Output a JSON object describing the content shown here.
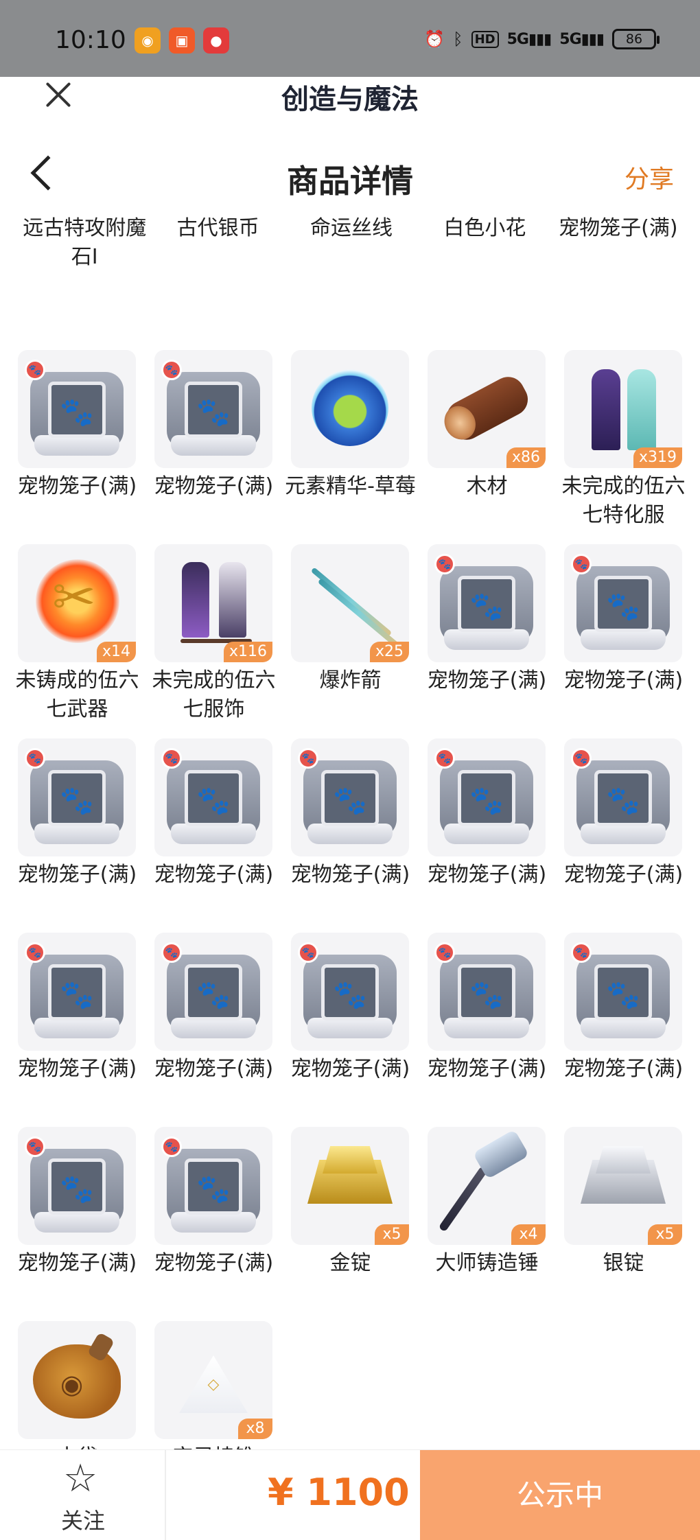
{
  "status_bar": {
    "time": "10:10",
    "network_hd": "HD",
    "signal_1": "5G",
    "signal_2": "5G",
    "battery": "86"
  },
  "mini_program": {
    "title": "创造与魔法"
  },
  "header": {
    "title": "商品详情",
    "share": "分享"
  },
  "top_labels": [
    "远古特攻附魔石I",
    "古代银币",
    "命运丝线",
    "白色小花",
    "宠物笼子(满)"
  ],
  "items": [
    {
      "label": "宠物笼子(满)",
      "art": "cage",
      "qty": ""
    },
    {
      "label": "宠物笼子(满)",
      "art": "cage",
      "qty": ""
    },
    {
      "label": "元素精华-草莓",
      "art": "orb",
      "qty": ""
    },
    {
      "label": "木材",
      "art": "log",
      "qty": "x86"
    },
    {
      "label": "未完成的伍六七特化服",
      "art": "robe",
      "qty": "x319"
    },
    {
      "label": "未铸成的伍六七武器",
      "art": "scissors",
      "qty": "x14"
    },
    {
      "label": "未完成的伍六七服饰",
      "art": "stand",
      "qty": "x116"
    },
    {
      "label": "爆炸箭",
      "art": "arrow",
      "qty": "x25"
    },
    {
      "label": "宠物笼子(满)",
      "art": "cage",
      "qty": ""
    },
    {
      "label": "宠物笼子(满)",
      "art": "cage",
      "qty": ""
    },
    {
      "label": "宠物笼子(满)",
      "art": "cage",
      "qty": ""
    },
    {
      "label": "宠物笼子(满)",
      "art": "cage",
      "qty": ""
    },
    {
      "label": "宠物笼子(满)",
      "art": "cage",
      "qty": ""
    },
    {
      "label": "宠物笼子(满)",
      "art": "cage",
      "qty": ""
    },
    {
      "label": "宠物笼子(满)",
      "art": "cage",
      "qty": ""
    },
    {
      "label": "宠物笼子(满)",
      "art": "cage",
      "qty": ""
    },
    {
      "label": "宠物笼子(满)",
      "art": "cage",
      "qty": ""
    },
    {
      "label": "宠物笼子(满)",
      "art": "cage",
      "qty": ""
    },
    {
      "label": "宠物笼子(满)",
      "art": "cage",
      "qty": ""
    },
    {
      "label": "宠物笼子(满)",
      "art": "cage",
      "qty": ""
    },
    {
      "label": "宠物笼子(满)",
      "art": "cage",
      "qty": ""
    },
    {
      "label": "宠物笼子(满)",
      "art": "cage",
      "qty": ""
    },
    {
      "label": "金锭",
      "art": "gold",
      "qty": "x5"
    },
    {
      "label": "大师铸造锤",
      "art": "hammer",
      "qty": "x4"
    },
    {
      "label": "银锭",
      "art": "silver",
      "qty": "x5"
    },
    {
      "label": "水袋",
      "art": "pouch",
      "qty": ""
    },
    {
      "label": "空灵棱锥",
      "art": "pyramid",
      "qty": "x8"
    }
  ],
  "bottom_bar": {
    "follow": "关注",
    "price": "¥ 1100",
    "status_button": "公示中"
  },
  "colors": {
    "accent": "#f0711f",
    "button_bg": "#f9a46e",
    "qty_badge": "#f2954a"
  }
}
